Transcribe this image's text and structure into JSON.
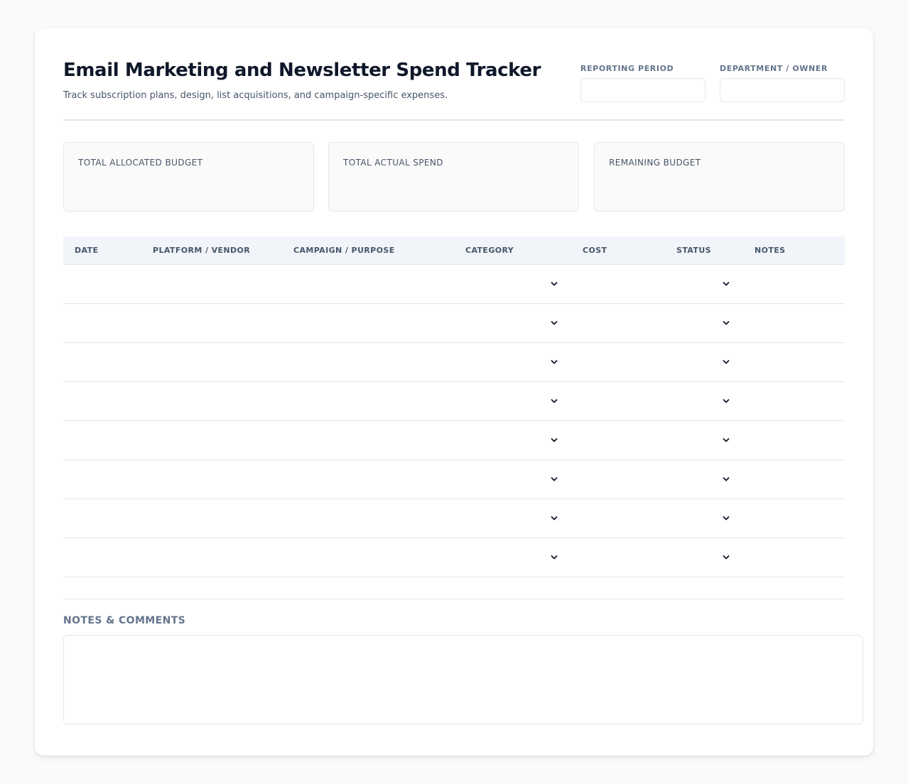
{
  "header": {
    "title": "Email Marketing and Newsletter Spend Tracker",
    "subtitle": "Track subscription plans, design, list acquisitions, and campaign-specific expenses.",
    "reporting_period": {
      "label": "REPORTING PERIOD",
      "value": ""
    },
    "department_owner": {
      "label": "DEPARTMENT / OWNER",
      "value": ""
    }
  },
  "summary": {
    "allocated": {
      "label": "TOTAL ALLOCATED BUDGET",
      "value": ""
    },
    "actual": {
      "label": "TOTAL ACTUAL SPEND",
      "value": ""
    },
    "remaining": {
      "label": "REMAINING BUDGET",
      "value": ""
    }
  },
  "table": {
    "columns": [
      "DATE",
      "PLATFORM / VENDOR",
      "CAMPAIGN / PURPOSE",
      "CATEGORY",
      "COST",
      "STATUS",
      "NOTES"
    ],
    "rows": [
      {
        "date": "",
        "vendor": "",
        "purpose": "",
        "category": "",
        "cost": "",
        "status": "",
        "notes": ""
      },
      {
        "date": "",
        "vendor": "",
        "purpose": "",
        "category": "",
        "cost": "",
        "status": "",
        "notes": ""
      },
      {
        "date": "",
        "vendor": "",
        "purpose": "",
        "category": "",
        "cost": "",
        "status": "",
        "notes": ""
      },
      {
        "date": "",
        "vendor": "",
        "purpose": "",
        "category": "",
        "cost": "",
        "status": "",
        "notes": ""
      },
      {
        "date": "",
        "vendor": "",
        "purpose": "",
        "category": "",
        "cost": "",
        "status": "",
        "notes": ""
      },
      {
        "date": "",
        "vendor": "",
        "purpose": "",
        "category": "",
        "cost": "",
        "status": "",
        "notes": ""
      },
      {
        "date": "",
        "vendor": "",
        "purpose": "",
        "category": "",
        "cost": "",
        "status": "",
        "notes": ""
      },
      {
        "date": "",
        "vendor": "",
        "purpose": "",
        "category": "",
        "cost": "",
        "status": "",
        "notes": ""
      }
    ]
  },
  "notes": {
    "label": "NOTES & COMMENTS",
    "value": ""
  },
  "icons": {
    "dropdown": "chevron-down-icon"
  },
  "colors": {
    "page_bg": "#f8fafc",
    "card_bg": "#ffffff",
    "title": "#0f172a",
    "muted": "#64748b",
    "border": "#e2e8f0",
    "table_header_bg": "#f1f5f9"
  }
}
